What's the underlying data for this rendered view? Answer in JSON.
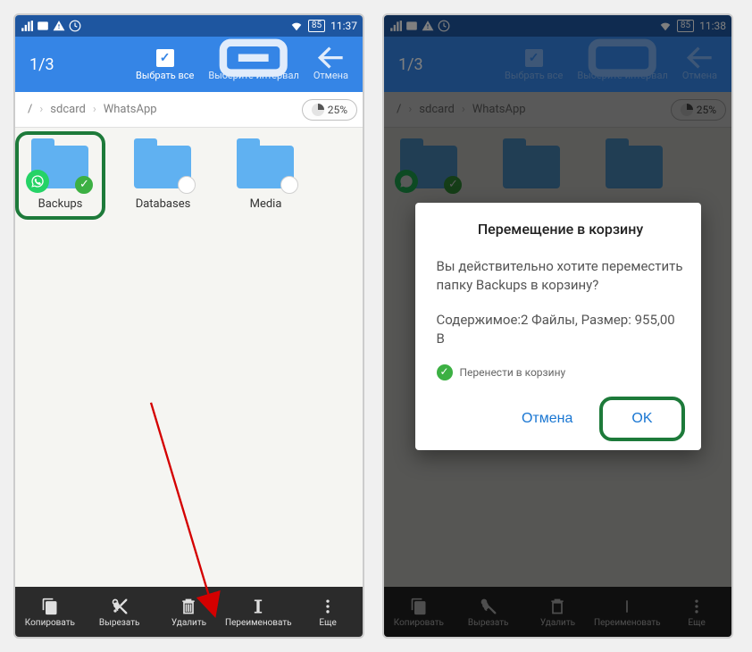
{
  "left": {
    "status": {
      "time": "11:37",
      "battery": "85"
    },
    "toolbar": {
      "count": "1/3",
      "selectAll": "Выбрать все",
      "selectRange": "Выберите интервал",
      "cancel": "Отмена"
    },
    "breadcrumb": {
      "root": "/",
      "seg1": "sdcard",
      "seg2": "WhatsApp",
      "usage": "25%"
    },
    "folders": {
      "backups": "Backups",
      "databases": "Databases",
      "media": "Media"
    },
    "bottom": {
      "copy": "Копировать",
      "cut": "Вырезать",
      "delete": "Удалить",
      "rename": "Переименовать",
      "more": "Еще"
    }
  },
  "right": {
    "status": {
      "time": "11:38",
      "battery": "85"
    },
    "toolbar": {
      "count": "1/3",
      "selectAll": "Выбрать все",
      "selectRange": "Выберите интервал",
      "cancel": "Отмена"
    },
    "breadcrumb": {
      "root": "/",
      "seg1": "sdcard",
      "seg2": "WhatsApp",
      "usage": "25%"
    },
    "dialog": {
      "title": "Перемещение в корзину",
      "body1": "Вы действительно хотите переместить папку Backups в корзину?",
      "body2": "Содержимое:2 Файлы, Размер: 955,00 B",
      "check": "Перенести в корзину",
      "cancel": "Отмена",
      "ok": "OK"
    },
    "bottom": {
      "copy": "Копировать",
      "cut": "Вырезать",
      "delete": "Удалить",
      "rename": "Переименовать",
      "more": "Еще"
    }
  }
}
